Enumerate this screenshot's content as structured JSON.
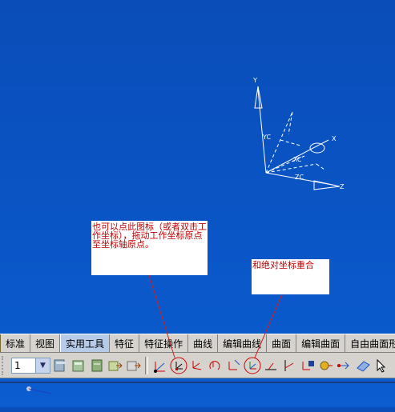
{
  "viewport": {
    "axis_labels": {
      "y": "Y",
      "x": "X",
      "z": "Z",
      "yc": "YC",
      "xc": "XC",
      "zc": "ZC"
    }
  },
  "callouts": [
    {
      "text": "也可以点此图标（或者双击工作坐标），拖动工作坐标原点至坐标轴原点。"
    },
    {
      "text": "和绝对坐标重合"
    }
  ],
  "tabs": [
    {
      "label": "标准"
    },
    {
      "label": "视图"
    },
    {
      "label": "实用工具",
      "active": true
    },
    {
      "label": "特征"
    },
    {
      "label": "特征操作"
    },
    {
      "label": "曲线"
    },
    {
      "label": "编辑曲线"
    },
    {
      "label": "曲面"
    },
    {
      "label": "编辑曲面"
    },
    {
      "label": "自由曲面形"
    }
  ],
  "toolbar": {
    "layer_value": "1",
    "dropdown_glyph": "▼"
  },
  "colors": {
    "background": "#0a55c6",
    "callout_text": "#c00000",
    "highlight_circle": "#cc0000",
    "toolbar_bg": "#d6d3ce"
  }
}
